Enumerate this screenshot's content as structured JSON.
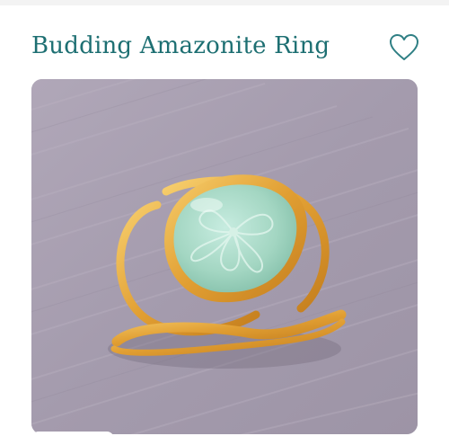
{
  "product": {
    "title": "Budding Amazonite Ring",
    "wishlist_icon": "heart-outline-icon",
    "image_alt": "Gold open-band ring set with a carved amazonite stone"
  },
  "colors": {
    "title": "#1d6f72",
    "accent": "#2f7f84",
    "background": "#ffffff",
    "photo_backdrop": "#a89fb0",
    "gold": "#e0a23a",
    "stone": "#a8d8c4"
  }
}
